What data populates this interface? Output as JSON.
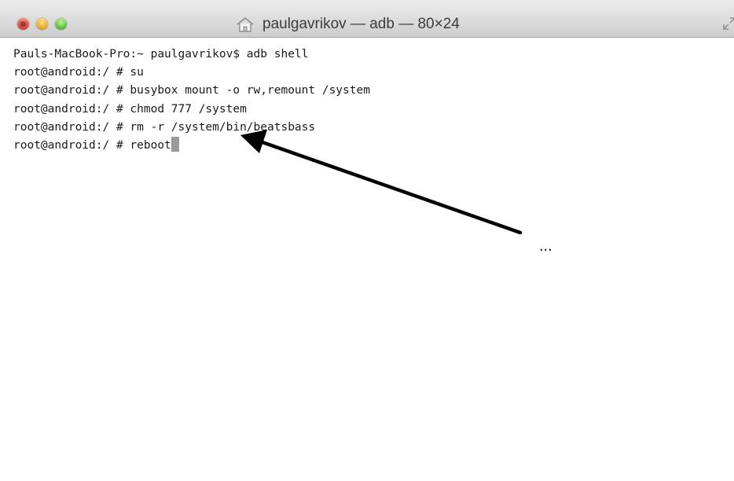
{
  "window": {
    "title": "paulgavrikov — adb — 80×24"
  },
  "terminal": {
    "lines": [
      "Pauls-MacBook-Pro:~ paulgavrikov$ adb shell",
      "root@android:/ # su",
      "root@android:/ # busybox mount -o rw,remount /system",
      "root@android:/ # chmod 777 /system",
      "root@android:/ # rm -r /system/bin/beatsbass",
      "root@android:/ # reboot"
    ]
  },
  "annotation": {
    "text": "..."
  },
  "icons": {
    "title_icon": "home-icon",
    "fullscreen": "fullscreen-icon"
  }
}
